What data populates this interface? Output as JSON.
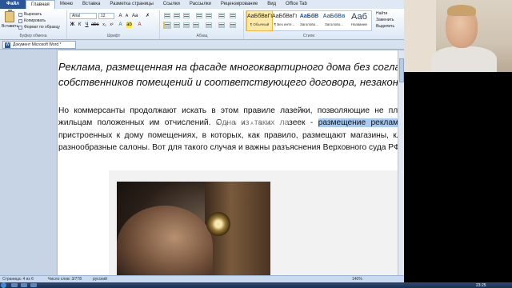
{
  "ribbon": {
    "tabs": [
      {
        "label": "Файл"
      },
      {
        "label": "Главная"
      },
      {
        "label": "Меню"
      },
      {
        "label": "Вставка"
      },
      {
        "label": "Разметка страницы"
      },
      {
        "label": "Ссылки"
      },
      {
        "label": "Рассылки"
      },
      {
        "label": "Рецензирование"
      },
      {
        "label": "Вид"
      },
      {
        "label": "Office Tab"
      }
    ],
    "clipboard": {
      "paste_label": "Вставить",
      "cut_label": "Вырезать",
      "copy_label": "Копировать",
      "format_painter_label": "Формат по образцу",
      "group_label": "Буфер обмена"
    },
    "font": {
      "font_name": "Arial",
      "font_size": "12",
      "group_label": "Шрифт"
    },
    "paragraph": {
      "group_label": "Абзац"
    },
    "styles": {
      "group_label": "Стили",
      "items": [
        {
          "sample": "АаБбВвГг,",
          "name": "¶ Обычный"
        },
        {
          "sample": "АаБбВвГг,",
          "name": "¶ Без инте..."
        },
        {
          "sample": "АаБбВ",
          "name": "Заголово..."
        },
        {
          "sample": "АаБбВв",
          "name": "Заголово..."
        },
        {
          "sample": "Ааб",
          "name": "Название"
        },
        {
          "sample": "АаБбВв",
          "name": "Подзагол..."
        }
      ]
    },
    "right": {
      "change_styles_label": "Изменить стили",
      "find_label": "Найти",
      "replace_label": "Заменить",
      "select_label": "Выделить",
      "editing_label": "Редактиров."
    }
  },
  "document": {
    "tab_title": "Документ Microsoft Word *",
    "headline": "Реклама, размещенная на фасаде многоквартирного дома без согласия собственников помещений и соответствующего договора, незаконна",
    "paragraph_before": "Но коммерсанты продолжают искать в этом правиле лазейки, позволяющие не платить жильцам положенных им отчислений. Одна из таких лазеек - ",
    "paragraph_highlight": "размещение рекламы на",
    "paragraph_after": " пристроенных к дому помещениях, в которых, как правило, размещают магазины, клубы, разнообразные салоны. Вот для такого случая и важны разъяснения Верховного суда РФ.",
    "mini_toolbar": "Ж К Ч A A ✎ A"
  },
  "status_bar": {
    "page": "Страница: 4 из 6",
    "words": "Число слов: 3/778",
    "language": "русский",
    "zoom": "140%"
  },
  "taskbar": {
    "time": "23:25"
  }
}
